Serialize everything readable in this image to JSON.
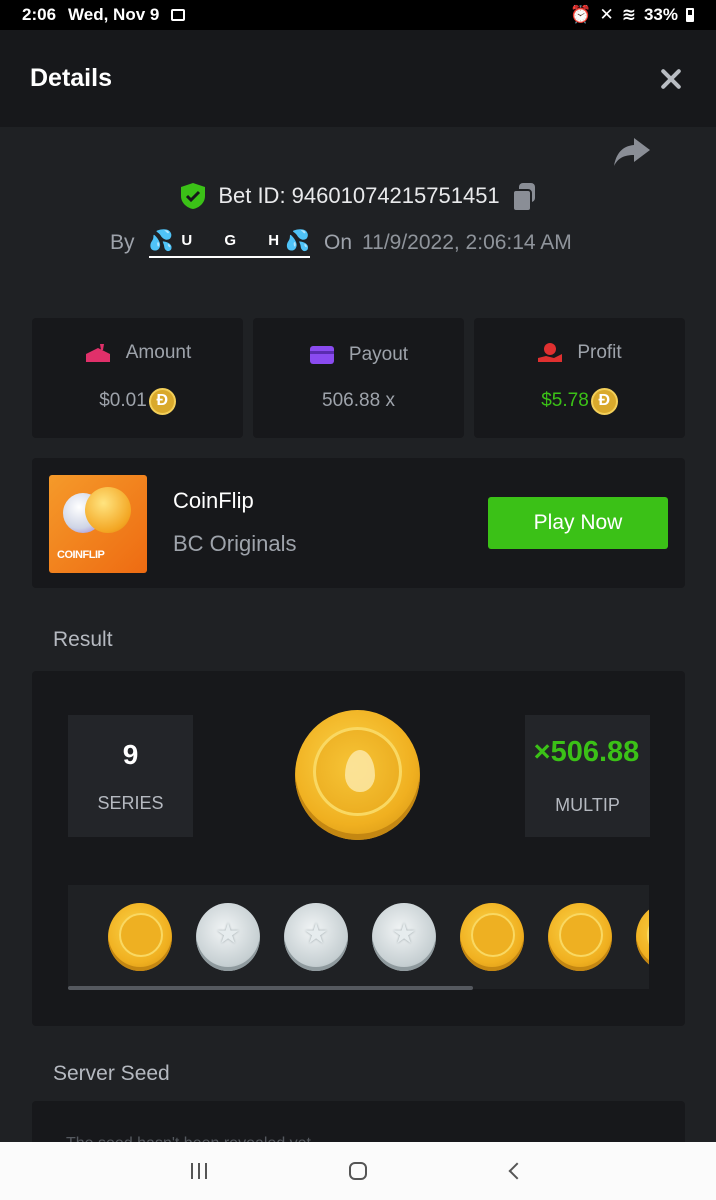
{
  "status_bar": {
    "time": "2:06",
    "date": "Wed, Nov 9",
    "battery": "33%"
  },
  "header": {
    "title": "Details"
  },
  "bet": {
    "id_label": "Bet ID: 94601074215751451",
    "by_label": "By",
    "username": "U G H",
    "on_label": "On",
    "datetime": "11/9/2022, 2:06:14 AM"
  },
  "stats": {
    "amount_label": "Amount",
    "amount_value": "$0.01",
    "payout_label": "Payout",
    "payout_value": "506.88 x",
    "profit_label": "Profit",
    "profit_value": "$5.78",
    "currency_symbol": "Ð"
  },
  "game": {
    "name": "CoinFlip",
    "provider": "BC Originals",
    "thumb_label": "COINFLIP",
    "play_label": "Play Now"
  },
  "result": {
    "title": "Result",
    "series_value": "9",
    "series_label": "SERIES",
    "multiplier_value": "×506.88",
    "multiplier_label": "MULTIP",
    "coins": [
      "gold",
      "silver",
      "silver",
      "silver",
      "gold",
      "gold",
      "gold"
    ]
  },
  "server_seed": {
    "title": "Server Seed",
    "hint": "The seed hasn't been revealed yet"
  },
  "colors": {
    "accent_green": "#3bc117",
    "background": "#1f2124",
    "panel": "#17181b"
  }
}
